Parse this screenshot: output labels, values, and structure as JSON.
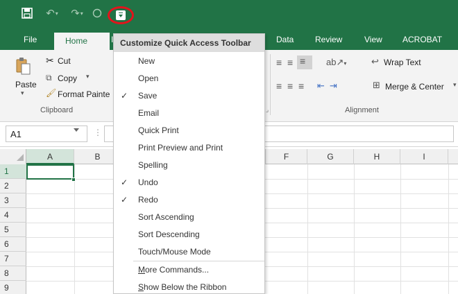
{
  "qat": {
    "save_icon": "save-icon",
    "undo_icon": "undo-icon",
    "redo_icon": "redo-icon",
    "touch_icon": "touch-mode-icon",
    "customize_icon": "customize-qat-icon"
  },
  "tabs": {
    "file": "File",
    "home": "Home",
    "insert_partial": "I",
    "data": "Data",
    "review": "Review",
    "view": "View",
    "acrobat": "ACROBAT"
  },
  "ribbon": {
    "clipboard": {
      "paste": "Paste",
      "cut": "Cut",
      "copy": "Copy",
      "format_painter": "Format Painte",
      "group_label": "Clipboard"
    },
    "alignment": {
      "wrap_text": "Wrap Text",
      "merge_center": "Merge & Center",
      "group_label": "Alignment"
    }
  },
  "formula_bar": {
    "name_box": "A1",
    "dots": "⋮"
  },
  "grid": {
    "columns": [
      "A",
      "B",
      "F",
      "G",
      "H",
      "I"
    ],
    "rows": [
      "1",
      "2",
      "3",
      "4",
      "5",
      "6",
      "7",
      "8",
      "9"
    ],
    "selected_cell": "A1"
  },
  "menu": {
    "title": "Customize Quick Access Toolbar",
    "items": [
      {
        "label": "New",
        "checked": false
      },
      {
        "label": "Open",
        "checked": false
      },
      {
        "label": "Save",
        "checked": true
      },
      {
        "label": "Email",
        "checked": false
      },
      {
        "label": "Quick Print",
        "checked": false
      },
      {
        "label": "Print Preview and Print",
        "checked": false
      },
      {
        "label": "Spelling",
        "checked": false
      },
      {
        "label": "Undo",
        "checked": true
      },
      {
        "label": "Redo",
        "checked": true
      },
      {
        "label": "Sort Ascending",
        "checked": false
      },
      {
        "label": "Sort Descending",
        "checked": false
      },
      {
        "label": "Touch/Mouse Mode",
        "checked": false
      }
    ],
    "more_commands": "More Commands...",
    "show_below": "Show Below the Ribbon",
    "check_mark": "✓"
  },
  "colors": {
    "excel_green": "#217346",
    "highlight_red": "#e2141c"
  }
}
